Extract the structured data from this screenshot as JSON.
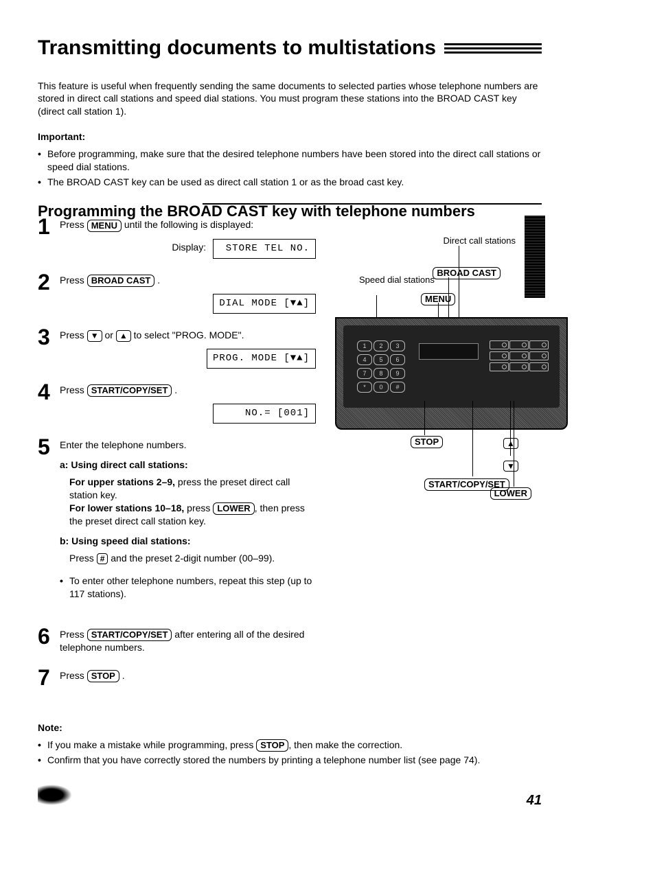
{
  "title": "Transmitting documents to multistations",
  "intro": "This feature is useful when frequently sending the same documents to selected parties whose telephone numbers are stored in direct call stations and speed dial stations. You must program these stations into the BROAD CAST key (direct call station 1).",
  "important": {
    "label": "Important:",
    "items": [
      "Before programming, make sure that the desired telephone numbers have been stored into the direct call stations or speed dial stations.",
      "The BROAD CAST key can be used as direct call station 1 or as the broad cast key."
    ]
  },
  "subheading": "Programming the BROAD CAST key with telephone numbers",
  "steps": {
    "s1": {
      "num": "1",
      "text_before": "Press ",
      "key": "MENU",
      "text_after": " until the following is displayed:",
      "display_label": "Display:",
      "lcd": "STORE TEL NO."
    },
    "s2": {
      "num": "2",
      "text_before": "Press ",
      "key": "BROAD CAST",
      "text_after": ".",
      "lcd": "DIAL MODE   [▼▲]"
    },
    "s3": {
      "num": "3",
      "text_before": "Press ",
      "key1": "▼",
      "mid": " or ",
      "key2": "▲",
      "text_after": " to select \"PROG. MODE\".",
      "lcd": "PROG. MODE  [▼▲]"
    },
    "s4": {
      "num": "4",
      "text_before": "Press ",
      "key": "START/COPY/SET",
      "text_after": ".",
      "lcd": "NO.=       [001]"
    },
    "s5": {
      "num": "5",
      "text": "Enter the telephone numbers.",
      "a": {
        "label": "a: Using direct call stations:",
        "upper_bold": "For upper stations 2–9,",
        "upper_rest": " press the preset direct call station key.",
        "lower_bold": "For lower stations 10–18,",
        "lower_rest1": " press ",
        "lower_key": "LOWER",
        "lower_rest2": ", then press the preset direct call station key."
      },
      "b": {
        "label": "b: Using speed dial stations:",
        "text_before": "Press ",
        "key": "#",
        "text_after": " and the preset 2-digit number (00–99)."
      },
      "bullet": "To enter other telephone numbers, repeat this step (up to 117 stations)."
    },
    "s6": {
      "num": "6",
      "text_before": "Press ",
      "key": "START/COPY/SET",
      "text_after": " after entering all of the desired telephone numbers."
    },
    "s7": {
      "num": "7",
      "text_before": "Press ",
      "key": "STOP",
      "text_after": "."
    }
  },
  "diagram": {
    "direct_call": "Direct call stations",
    "speed_dial": "Speed dial stations",
    "broad_cast": "BROAD CAST",
    "menu": "MENU",
    "stop": "STOP",
    "up": "▲",
    "down": "▼",
    "start": "START/COPY/SET",
    "lower": "LOWER",
    "keypad": [
      "1",
      "2",
      "3",
      "4",
      "5",
      "6",
      "7",
      "8",
      "9",
      "*",
      "0",
      "#"
    ]
  },
  "note": {
    "label": "Note:",
    "items": [
      {
        "before": "If you make a mistake while programming, press ",
        "key": "STOP",
        "after": ", then make the correction."
      },
      {
        "plain": "Confirm that you have correctly stored the numbers by printing a telephone number list (see page 74)."
      }
    ]
  },
  "page": "41"
}
